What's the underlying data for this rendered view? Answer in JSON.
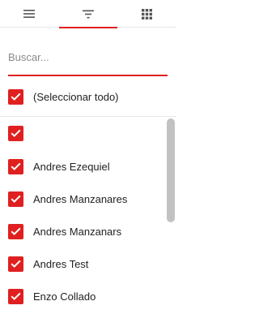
{
  "tabs": [
    {
      "icon": "menu-icon",
      "active": false
    },
    {
      "icon": "filter-icon",
      "active": true
    },
    {
      "icon": "grid-icon",
      "active": false
    }
  ],
  "search": {
    "placeholder": "Buscar...",
    "value": ""
  },
  "select_all": {
    "label": "(Seleccionar todo)",
    "checked": true
  },
  "items": [
    {
      "label": "",
      "checked": true
    },
    {
      "label": "Andres Ezequiel",
      "checked": true
    },
    {
      "label": "Andres Manzanares",
      "checked": true
    },
    {
      "label": "Andres Manzanars",
      "checked": true
    },
    {
      "label": "Andres Test",
      "checked": true
    },
    {
      "label": "Enzo Collado",
      "checked": true
    }
  ],
  "colors": {
    "accent": "#e02020",
    "scrollbar": "#c2c2c2"
  }
}
